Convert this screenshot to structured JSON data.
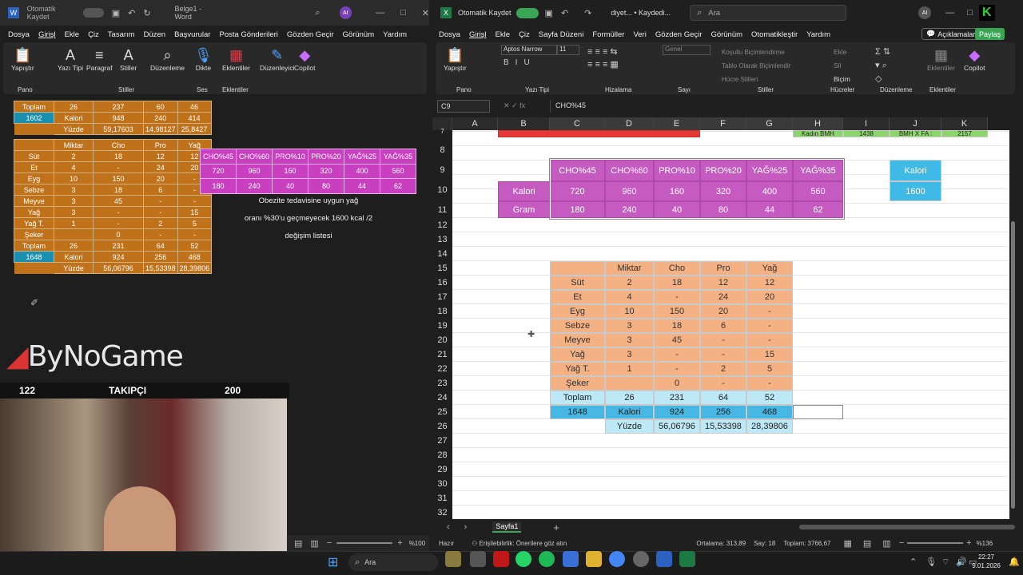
{
  "word": {
    "autosave": "Otomatik Kaydet",
    "doc": "Belge1 - Word",
    "avatar": "AI",
    "menu": [
      "Dosya",
      "Girişl",
      "Ekle",
      "Çiz",
      "Tasarım",
      "Düzen",
      "Başvurular",
      "Posta Gönderileri",
      "Gözden Geçir",
      "Görünüm",
      "Yardım"
    ],
    "ribbon": [
      "Yapıştır",
      "Yazı Tipi",
      "Paragraf",
      "Stiller",
      "Düzenleme",
      "Dikte",
      "Eklentiler",
      "Düzenleyici",
      "Copilot"
    ],
    "groups": [
      "Pano",
      "Stiller",
      "Ses",
      "Eklentiler"
    ],
    "top_table": {
      "rows": [
        [
          "Toplam",
          "26",
          "237",
          "60",
          "46"
        ],
        [
          "1602",
          "Kalori",
          "948",
          "240",
          "414"
        ],
        [
          "",
          "Yüzde",
          "59,17603",
          "14,98127",
          "25,8427"
        ]
      ]
    },
    "food_table": {
      "header": [
        "",
        "Miktar",
        "Cho",
        "Pro",
        "Yağ"
      ],
      "rows": [
        [
          "Süt",
          "2",
          "18",
          "12",
          "12"
        ],
        [
          "Et",
          "4",
          "-",
          "24",
          "20"
        ],
        [
          "Eyg",
          "10",
          "150",
          "20",
          "-"
        ],
        [
          "Sebze",
          "3",
          "18",
          "6",
          "-"
        ],
        [
          "Meyve",
          "3",
          "45",
          "-",
          "-"
        ],
        [
          "Yağ",
          "3",
          "-",
          "-",
          "15"
        ],
        [
          "Yağ T.",
          "1",
          "-",
          "2",
          "5"
        ],
        [
          "Şeker",
          "",
          "0",
          "-",
          "-"
        ]
      ],
      "total": [
        "Toplam",
        "26",
        "231",
        "64",
        "52"
      ],
      "kcal": [
        "1648",
        "Kalori",
        "924",
        "256",
        "468"
      ],
      "pct": [
        "Yüzde",
        "56,06796",
        "15,53398",
        "28,39806"
      ]
    },
    "pink_table": {
      "header": [
        "CHO%45",
        "CHO%60",
        "PRO%10",
        "PRO%20",
        "YAĞ%25",
        "YAĞ%35"
      ],
      "kalori": [
        "720",
        "960",
        "160",
        "320",
        "400",
        "560"
      ],
      "gram": [
        "180",
        "240",
        "40",
        "80",
        "44",
        "62"
      ]
    },
    "note1": "Obezite tedavisine uygun yağ",
    "note2": "oranı %30'u geçmeyecek 1600 kcal /2",
    "note3": "değişim listesi",
    "zoom": "%100"
  },
  "stream": {
    "brand": "ByNoGame",
    "left": "122",
    "mid": "TAKIPÇI",
    "right": "200"
  },
  "excel": {
    "autosave": "Otomatik Kaydet",
    "doc": "diyet... • Kaydedi...",
    "search": "Ara",
    "avatar": "AI",
    "menu": [
      "Dosya",
      "Girişl",
      "Ekle",
      "Çiz",
      "Sayfa Düzeni",
      "Formüller",
      "Veri",
      "Gözden Geçir",
      "Görünüm",
      "Otomatikleştir",
      "Yardım"
    ],
    "comments": "Açıklamalar",
    "share": "Paylaş",
    "font": "Aptos Narrow",
    "size": "11",
    "numfmt": "Genel",
    "cond": [
      "Koşullu Biçimlendirme",
      "Tablo Olarak Biçimlendir",
      "Hücre Stilleri"
    ],
    "cells_menu": [
      "Ekle",
      "Sil",
      "Biçim"
    ],
    "groups": [
      "Pano",
      "Yazı Tipi",
      "Hizalama",
      "Sayı",
      "Stiller",
      "Hücreler",
      "Düzenleme",
      "Eklentiler"
    ],
    "ribbon": [
      "Yapıştır",
      "Eklentiler",
      "Copilot"
    ],
    "namebox": "C9",
    "formula": "CHO%45",
    "cols": [
      "A",
      "B",
      "C",
      "D",
      "E",
      "F",
      "G",
      "H",
      "I",
      "J",
      "K"
    ],
    "rows": [
      "7",
      "8",
      "9",
      "10",
      "11",
      "12",
      "13",
      "14",
      "15",
      "16",
      "17",
      "18",
      "19",
      "20",
      "21",
      "22",
      "23",
      "24",
      "25",
      "26",
      "27",
      "28",
      "29",
      "30",
      "31",
      "32"
    ],
    "pink_hdr": [
      "CHO%45",
      "CHO%60",
      "PRO%10",
      "PRO%20",
      "YAĞ%25",
      "YAĞ%35"
    ],
    "kalori_lbl": "Kalori",
    "gram_lbl": "Gram",
    "kalori": [
      "720",
      "960",
      "160",
      "320",
      "400",
      "560"
    ],
    "gram": [
      "180",
      "240",
      "40",
      "80",
      "44",
      "62"
    ],
    "kal_box": "Kalori",
    "kal_val": "1600",
    "food_hdr": [
      "",
      "Miktar",
      "Cho",
      "Pro",
      "Yağ"
    ],
    "food": [
      [
        "Süt",
        "2",
        "18",
        "12",
        "12"
      ],
      [
        "Et",
        "4",
        "-",
        "24",
        "20"
      ],
      [
        "Eyg",
        "10",
        "150",
        "20",
        "-"
      ],
      [
        "Sebze",
        "3",
        "18",
        "6",
        "-"
      ],
      [
        "Meyve",
        "3",
        "45",
        "-",
        "-"
      ],
      [
        "Yağ",
        "3",
        "-",
        "-",
        "15"
      ],
      [
        "Yağ T.",
        "1",
        "-",
        "2",
        "5"
      ],
      [
        "Şeker",
        "",
        "0",
        "-",
        "-"
      ]
    ],
    "total": [
      "Toplam",
      "26",
      "231",
      "64",
      "52"
    ],
    "kcal": [
      "1648",
      "Kalori",
      "924",
      "256",
      "468"
    ],
    "pct": [
      "Yüzde",
      "56,06796",
      "15,53398",
      "28,39806"
    ],
    "row7": {
      "b": "",
      "h": "Kadın BMH",
      "i": "1438",
      "j": "BMH X FA :",
      "k": "2157"
    },
    "sheet": "Sayfa1",
    "status": {
      "ready": "Hazır",
      "access": "Erişilebilirlik: Önerilere göz atın",
      "avg": "Ortalama: 313,89",
      "count": "Say: 18",
      "sum": "Toplam: 3766,67",
      "zoom": "%136"
    }
  },
  "taskbar": {
    "search": "Ara",
    "time": "22:27",
    "date": "9.01.2026"
  }
}
